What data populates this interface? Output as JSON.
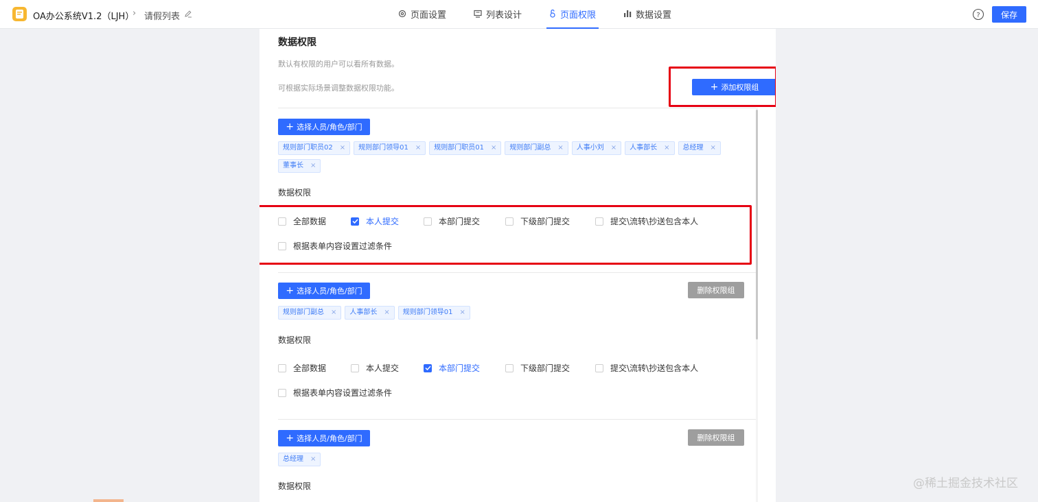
{
  "header": {
    "app_name": "OA办公系统V1.2（LJH）",
    "breadcrumb_sep": "›",
    "page_name": "请假列表",
    "tabs": [
      {
        "label": "页面设置",
        "icon": "gear-icon"
      },
      {
        "label": "列表设计",
        "icon": "list-design-icon"
      },
      {
        "label": "页面权限",
        "icon": "permission-icon",
        "active": true
      },
      {
        "label": "数据设置",
        "icon": "bar-chart-icon"
      }
    ],
    "save_label": "保存"
  },
  "panel": {
    "title": "数据权限",
    "desc1": "默认有权限的用户可以看所有数据。",
    "desc2": "可根据实际场景调整数据权限功能。",
    "add_group_label": "添加权限组",
    "select_label": "选择人员/角色/部门",
    "delete_label": "删除权限组",
    "data_perm_label": "数据权限",
    "options": [
      "全部数据",
      "本人提交",
      "本部门提交",
      "下级部门提交",
      "提交\\流转\\抄送包含本人",
      "根据表单内容设置过滤条件"
    ],
    "groups": [
      {
        "tags": [
          "规则部门职员02",
          "规则部门领导01",
          "规则部门职员01",
          "规则部门副总",
          "人事小刘",
          "人事部长",
          "总经理",
          "董事长"
        ],
        "checked": [
          false,
          true,
          false,
          false,
          false,
          false
        ]
      },
      {
        "tags": [
          "规则部门副总",
          "人事部长",
          "规则部门领导01"
        ],
        "checked": [
          false,
          false,
          true,
          false,
          false,
          false
        ]
      },
      {
        "tags": [
          "总经理"
        ],
        "checked": [
          false,
          false,
          false,
          false,
          false,
          false
        ]
      }
    ]
  },
  "watermark": "@稀土掘金技术社区",
  "colors": {
    "primary": "#2f6bff",
    "highlight": "#e60012",
    "disabled_btn": "#9e9e9e",
    "logo": "#f7b731"
  }
}
